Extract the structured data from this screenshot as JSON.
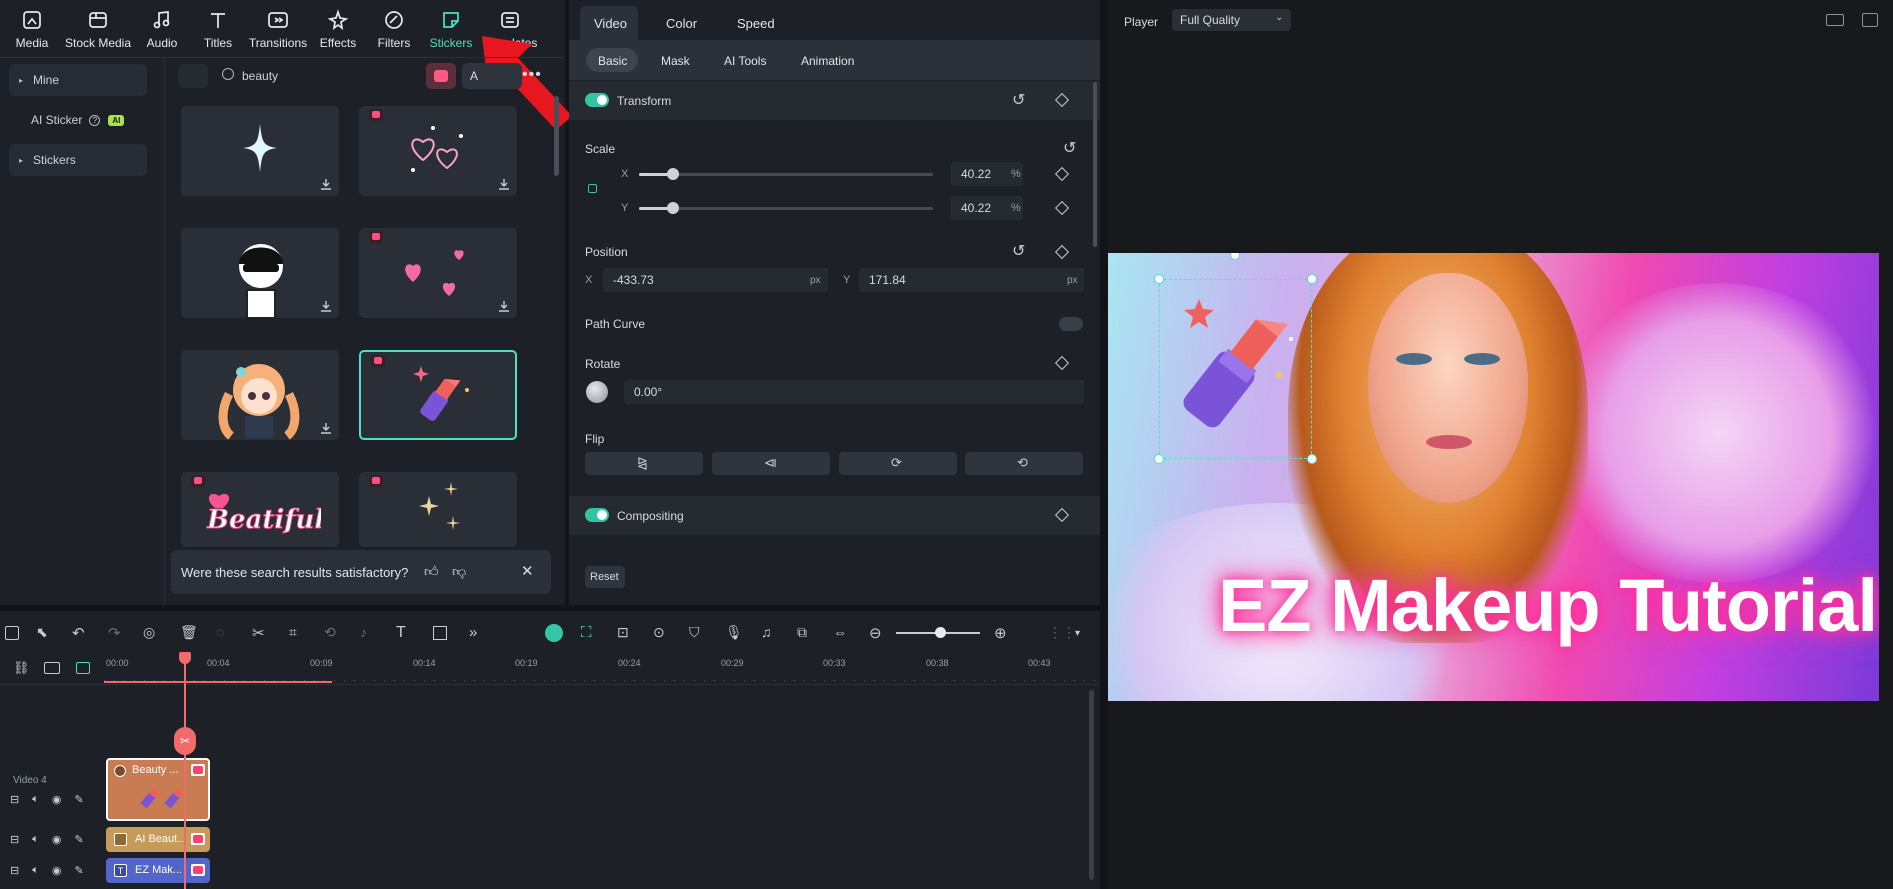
{
  "toolbar": {
    "items": [
      {
        "label": "Media",
        "icon": "media-icon"
      },
      {
        "label": "Stock Media",
        "icon": "stock-media-icon"
      },
      {
        "label": "Audio",
        "icon": "audio-icon"
      },
      {
        "label": "Titles",
        "icon": "titles-icon"
      },
      {
        "label": "Transitions",
        "icon": "transitions-icon"
      },
      {
        "label": "Effects",
        "icon": "effects-icon"
      },
      {
        "label": "Filters",
        "icon": "filters-icon"
      },
      {
        "label": "Stickers",
        "icon": "stickers-icon"
      },
      {
        "label": "Templates",
        "icon": "templates-icon"
      }
    ]
  },
  "sidebar": {
    "mine": "Mine",
    "ai_sticker": "AI Sticker",
    "ai_badge": "AI",
    "stickers": "Stickers"
  },
  "search": {
    "value": "beauty",
    "filter_label": "A"
  },
  "feedback": {
    "question": "Were these search results satisfactory?"
  },
  "props": {
    "tabs": [
      "Video",
      "Color",
      "Speed"
    ],
    "subtabs": [
      "Basic",
      "Mask",
      "AI Tools",
      "Animation"
    ],
    "transform": "Transform",
    "scale": "Scale",
    "x": "X",
    "y": "Y",
    "scale_x": "40.22",
    "scale_y": "40.22",
    "percent": "%",
    "position": "Position",
    "pos_x": "-433.73",
    "pos_y": "171.84",
    "px": "px",
    "path_curve": "Path Curve",
    "rotate": "Rotate",
    "rotate_val": "0.00°",
    "flip": "Flip",
    "compositing": "Compositing",
    "reset": "Reset"
  },
  "player": {
    "label": "Player",
    "quality": "Full Quality",
    "video_title": "EZ Makeup Tutorial"
  },
  "timeline": {
    "ticks": [
      "00:00",
      "00:04",
      "00:09",
      "00:14",
      "00:19",
      "00:24",
      "00:29",
      "00:33",
      "00:38",
      "00:43"
    ],
    "track_label": "Video 4",
    "clips": [
      "Beauty ...",
      "AI Beaut...",
      "EZ Mak..."
    ]
  },
  "colors": {
    "accent": "#4fe0c4",
    "playhead": "#f26b6b",
    "clip_sticker": "#c97b52",
    "clip_ai": "#c79a5a",
    "clip_title": "#5266c9"
  }
}
